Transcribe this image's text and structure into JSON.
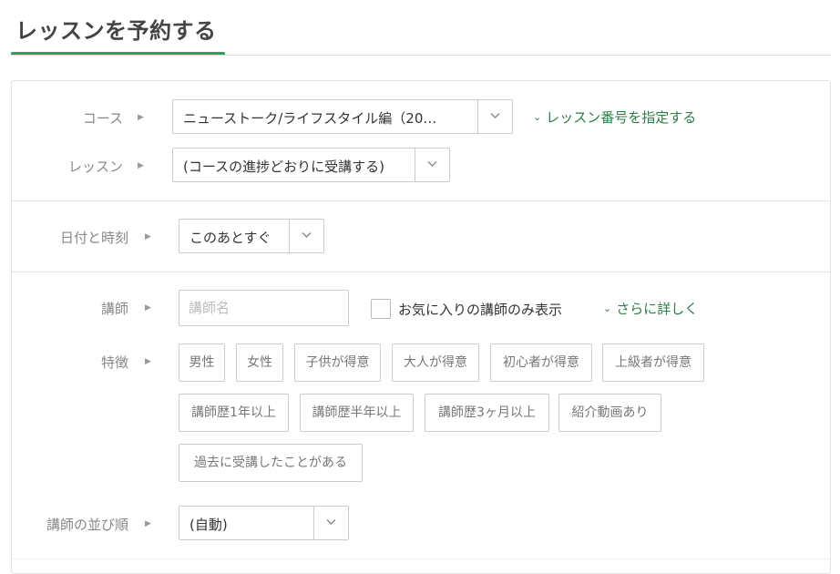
{
  "page": {
    "title": "レッスンを予約する",
    "accent_color": "#2e9e56"
  },
  "form": {
    "course": {
      "label": "コース",
      "selected": "ニューストーク/ライフスタイル編（20…"
    },
    "lesson_number_link": "レッスン番号を指定する",
    "lesson": {
      "label": "レッスン",
      "selected": "(コースの進捗どおりに受講する)"
    },
    "datetime": {
      "label": "日付と時刻",
      "selected": "このあとすぐ"
    },
    "teacher": {
      "label": "講師",
      "placeholder": "講師名",
      "value": "",
      "favorites_only_label": "お気に入りの講師のみ表示",
      "favorites_only_checked": false,
      "more_link": "さらに詳しく"
    },
    "features": {
      "label": "特徴",
      "tags": [
        "男性",
        "女性",
        "子供が得意",
        "大人が得意",
        "初心者が得意",
        "上級者が得意",
        "講師歴1年以上",
        "講師歴半年以上",
        "講師歴3ヶ月以上",
        "紹介動画あり",
        "過去に受講したことがある"
      ]
    },
    "sort": {
      "label": "講師の並び順",
      "selected": "(自動)"
    }
  },
  "icons": {
    "row_arrow": "triangle-right-icon",
    "dropdown": "chevron-down-icon",
    "link_chevron": "chevron-down-icon"
  }
}
